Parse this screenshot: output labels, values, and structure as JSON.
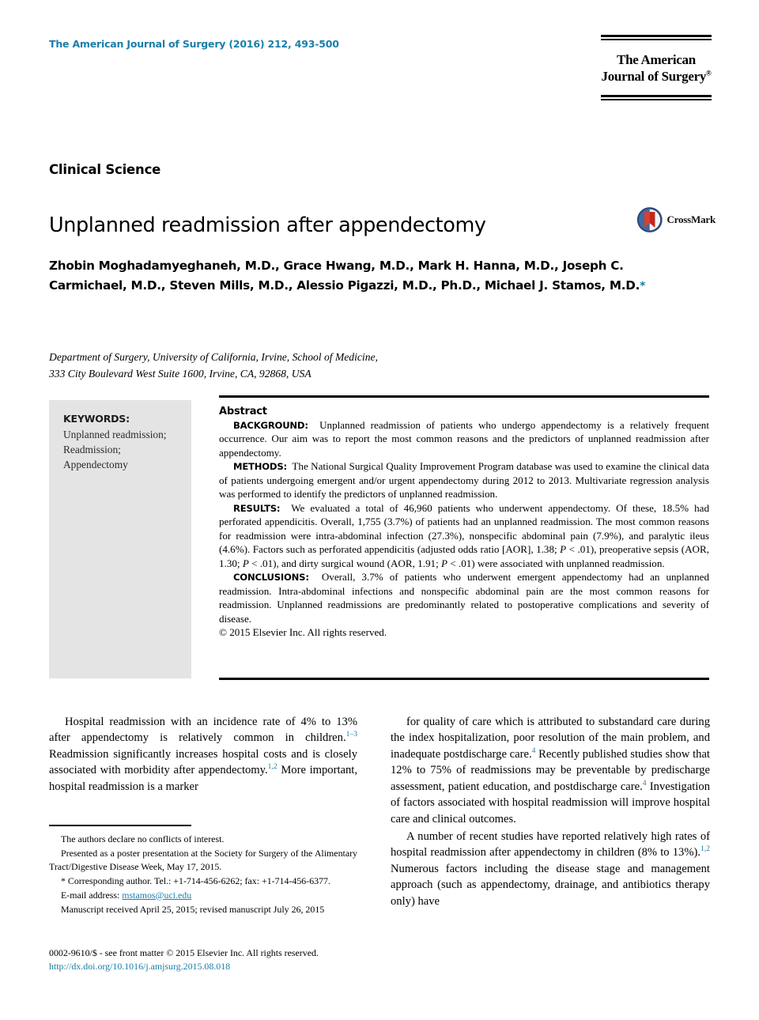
{
  "header": {
    "journal_citation": "The American Journal of Surgery (2016) 212, 493-500",
    "logo_line1": "The American",
    "logo_line2": "Journal of Surgery",
    "logo_registered": "®"
  },
  "article": {
    "section_label": "Clinical Science",
    "title": "Unplanned readmission after appendectomy",
    "crossmark_label": "CrossMark",
    "authors": "Zhobin Moghadamyeghaneh, M.D., Grace Hwang, M.D., Mark H. Hanna, M.D., Joseph C. Carmichael, M.D., Steven Mills, M.D., Alessio Pigazzi, M.D., Ph.D., Michael J. Stamos, M.D.",
    "corresponding_marker": "*",
    "affiliation_line1": "Department of Surgery, University of California, Irvine, School of Medicine,",
    "affiliation_line2": "333 City Boulevard West Suite 1600, Irvine, CA, 92868, USA"
  },
  "keywords": {
    "title": "KEYWORDS:",
    "items": "Unplanned readmission; Readmission; Appendectomy"
  },
  "abstract": {
    "heading": "Abstract",
    "background_label": "BACKGROUND:",
    "background_text": "Unplanned readmission of patients who undergo appendectomy is a relatively frequent occurrence. Our aim was to report the most common reasons and the predictors of unplanned readmission after appendectomy.",
    "methods_label": "METHODS:",
    "methods_text": "The National Surgical Quality Improvement Program database was used to examine the clinical data of patients undergoing emergent and/or urgent appendectomy during 2012 to 2013. Multivariate regression analysis was performed to identify the predictors of unplanned readmission.",
    "results_label": "RESULTS:",
    "results_text_a": "We evaluated a total of 46,960 patients who underwent appendectomy. Of these, 18.5% had perforated appendicitis. Overall, 1,755 (3.7%) of patients had an unplanned readmission. The most common reasons for readmission were intra-abdominal infection (27.3%), nonspecific abdominal pain (7.9%), and paralytic ileus (4.6%). Factors such as perforated appendicitis (adjusted odds ratio [AOR], 1.38; ",
    "results_p1": "P",
    "results_text_b": " < .01), preoperative sepsis (AOR, 1.30; ",
    "results_p2": "P",
    "results_text_c": " < .01), and dirty surgical wound (AOR, 1.91; ",
    "results_p3": "P",
    "results_text_d": " < .01) were associated with unplanned readmission.",
    "conclusions_label": "CONCLUSIONS:",
    "conclusions_text": "Overall, 3.7% of patients who underwent emergent appendectomy had an unplanned readmission. Intra-abdominal infections and nonspecific abdominal pain are the most common reasons for readmission. Unplanned readmissions are predominantly related to postoperative complications and severity of disease.",
    "copyright": "© 2015 Elsevier Inc. All rights reserved."
  },
  "body": {
    "left_para_a": "Hospital readmission with an incidence rate of 4% to 13% after appendectomy is relatively common in children.",
    "left_ref_1": "1–3",
    "left_para_b": " Readmission significantly increases hospital costs and is closely associated with morbidity after appendectomy.",
    "left_ref_2": "1,2",
    "left_para_c": " More important, hospital readmission is a marker",
    "right_para1_a": "for quality of care which is attributed to substandard care during the index hospitalization, poor resolution of the main problem, and inadequate postdischarge care.",
    "right_ref_1": "4",
    "right_para1_b": " Recently published studies show that 12% to 75% of readmissions may be preventable by predischarge assessment, patient education, and postdischarge care.",
    "right_ref_2": "4",
    "right_para1_c": " Investigation of factors associated with hospital readmission will improve hospital care and clinical outcomes.",
    "right_para2_a": "A number of recent studies have reported relatively high rates of hospital readmission after appendectomy in children (8% to 13%).",
    "right_ref_3": "1,2",
    "right_para2_b": " Numerous factors including the disease stage and management approach (such as appendectomy, drainage, and antibiotics therapy only) have"
  },
  "footnotes": {
    "conflict": "The authors declare no conflicts of interest.",
    "presented": "Presented as a poster presentation at the Society for Surgery of the Alimentary Tract/Digestive Disease Week, May 17, 2015.",
    "corresponding_marker": "*",
    "corresponding": " Corresponding author. Tel.: +1-714-456-6262; fax: +1-714-456-6377.",
    "email_label": "E-mail address:",
    "email": "mstamos@uci.edu",
    "manuscript": "Manuscript received April 25, 2015; revised manuscript July 26, 2015"
  },
  "footer": {
    "issn_line": "0002-9610/$ - see front matter © 2015 Elsevier Inc. All rights reserved.",
    "doi": "http://dx.doi.org/10.1016/j.amjsurg.2015.08.018"
  },
  "colors": {
    "link_blue": "#1a7ea8",
    "keywords_bg": "#e4e4e4"
  }
}
